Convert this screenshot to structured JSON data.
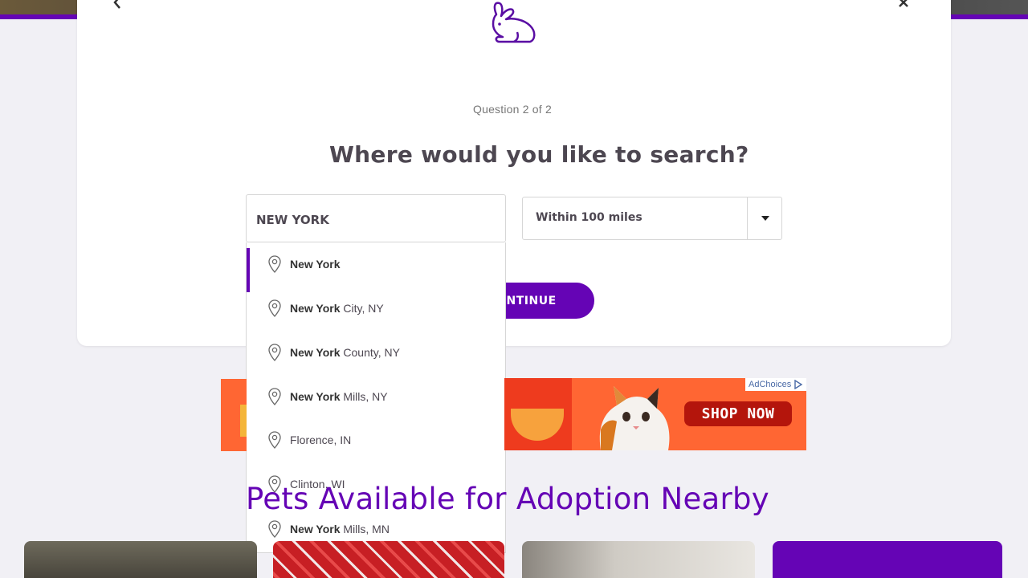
{
  "modal": {
    "question_count": "Question 2 of 2",
    "heading": "Where would you like to search?",
    "location_value": "NEW YORK",
    "distance_value": "Within 100 miles",
    "continue_label": "CONTINUE"
  },
  "suggestions": [
    {
      "bold": "New York",
      "rest": ""
    },
    {
      "bold": "New York",
      "rest": " City, NY"
    },
    {
      "bold": "New York",
      "rest": " County, NY"
    },
    {
      "bold": "New York",
      "rest": " Mills, NY"
    },
    {
      "bold": "",
      "rest": "Florence, IN"
    },
    {
      "bold": "",
      "rest": "Clinton, WI"
    },
    {
      "bold": "New York",
      "rest": " Mills, MN"
    }
  ],
  "ad": {
    "shop_label": "SHOP NOW",
    "adchoices_label": "AdChoices"
  },
  "section": {
    "heading": "Pets Available for Adoption Nearby"
  },
  "colors": {
    "brand_purple": "#6504b5",
    "ad_orange": "#ff6633"
  },
  "icons": {
    "back": "chevron-left-icon",
    "close": "close-icon",
    "rabbit": "rabbit-icon",
    "pin": "map-pin-icon",
    "caret": "caret-down-icon"
  }
}
